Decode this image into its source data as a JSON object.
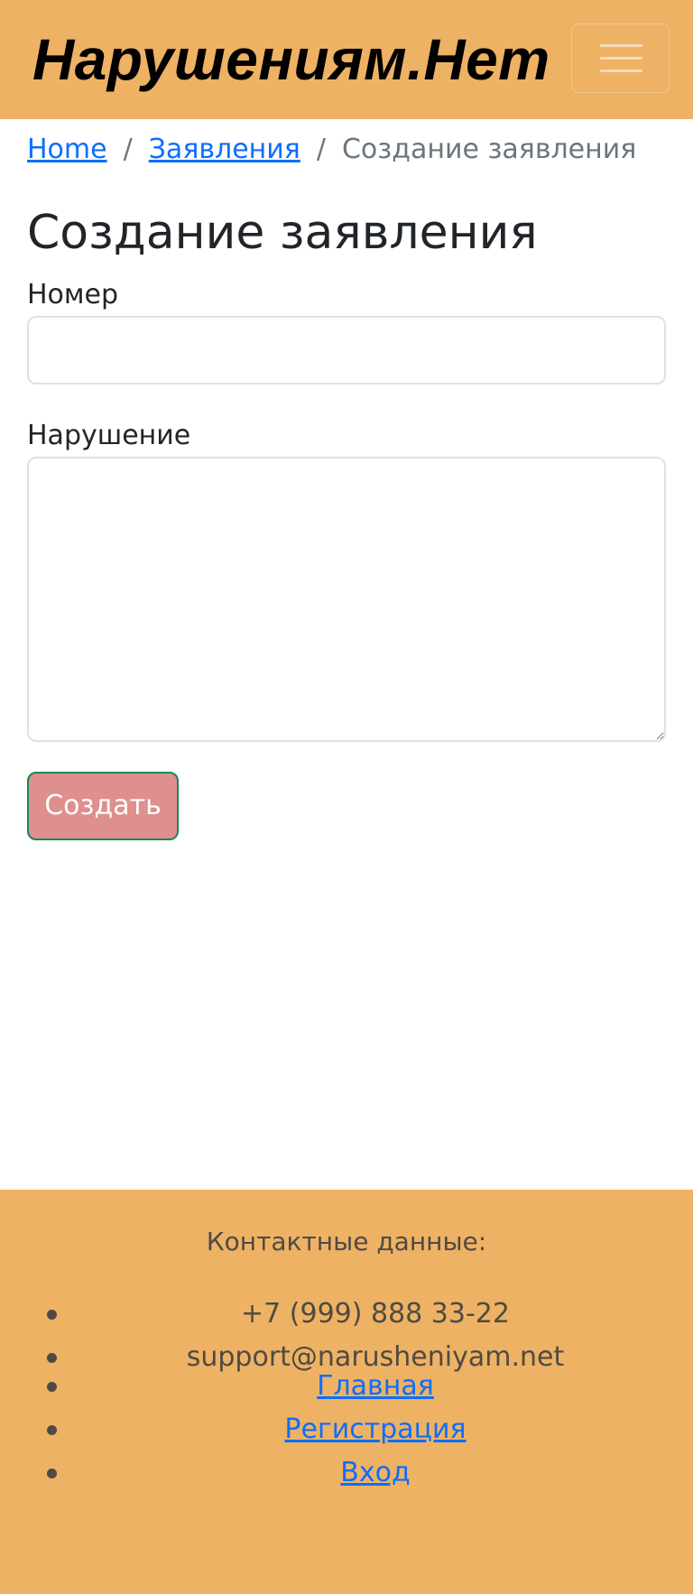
{
  "navbar": {
    "brand": "Нарушениям.Нет",
    "toggler_icon": "hamburger-menu-icon"
  },
  "breadcrumb": {
    "items": [
      {
        "label": "Home"
      },
      {
        "label": "Заявления"
      }
    ],
    "separator": "/",
    "current": "Создание заявления"
  },
  "page": {
    "title": "Создание заявления"
  },
  "form": {
    "number_label": "Номер",
    "number_value": "",
    "violation_label": "Нарушение",
    "violation_value": "",
    "submit_label": "Создать"
  },
  "footer": {
    "heading": "Контактные данные:",
    "contacts": [
      "+7 (999) 888 33-22",
      "support@narusheniyam.net"
    ],
    "links": [
      "Главная",
      "Регистрация",
      "Вход"
    ]
  },
  "colors": {
    "navbar_bg": "#eeb264",
    "footer_bg": "#eeb264",
    "link": "#0d6efd",
    "submit_bg": "#de8f8e",
    "submit_border": "#198754"
  }
}
